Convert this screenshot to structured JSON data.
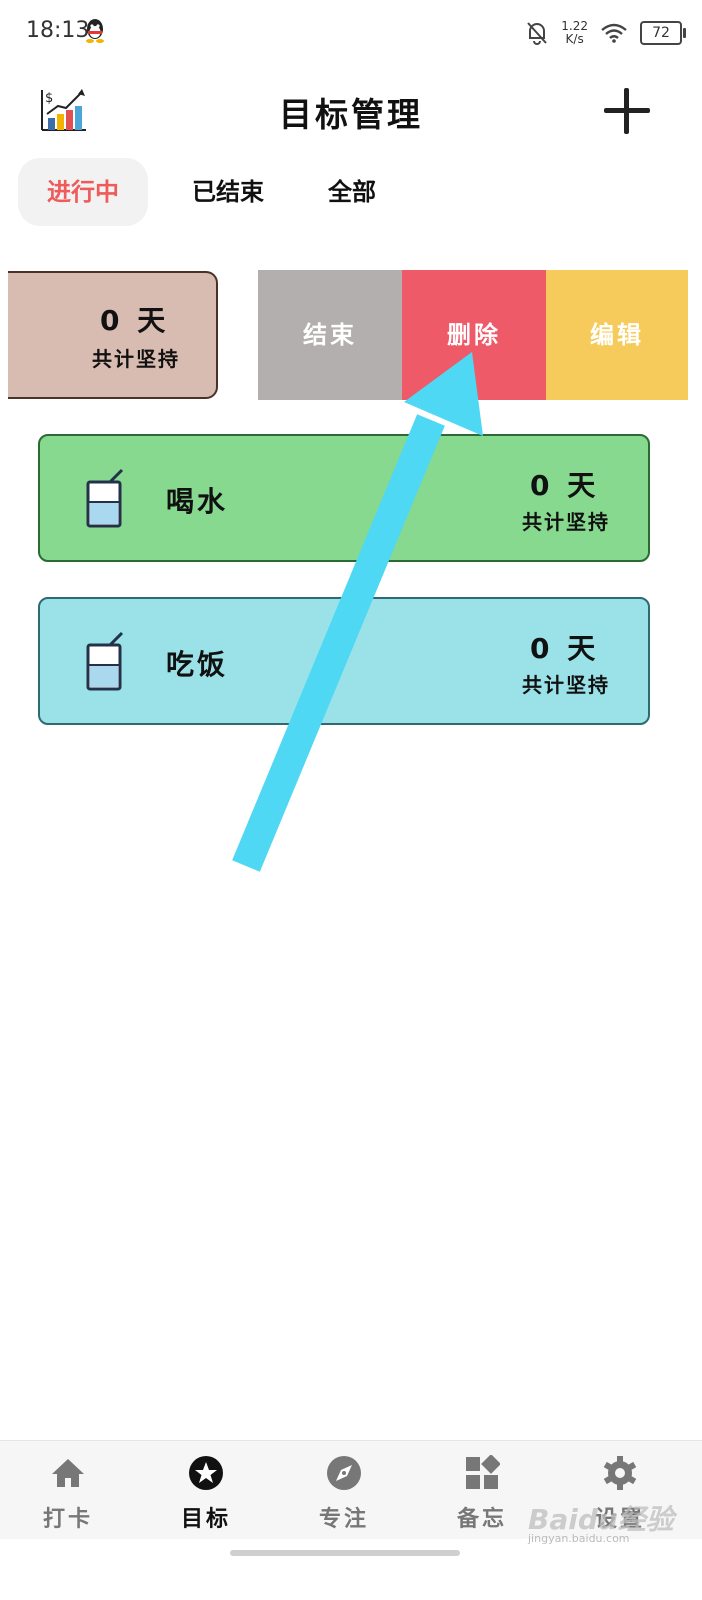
{
  "status_bar": {
    "time": "18:13",
    "net_speed_value": "1.22",
    "net_speed_unit": "K/s",
    "battery": "72"
  },
  "header": {
    "title": "目标管理"
  },
  "tabs": [
    {
      "label": "进行中",
      "active": true
    },
    {
      "label": "已结束",
      "active": false
    },
    {
      "label": "全部",
      "active": false
    }
  ],
  "swiped_goal": {
    "days": "0 天",
    "total_label": "共计坚持"
  },
  "swipe_actions": {
    "end": "结束",
    "delete": "删除",
    "edit": "编辑"
  },
  "goals": [
    {
      "name": "喝水",
      "days": "0 天",
      "total_label": "共计坚持",
      "color": "#86d98e"
    },
    {
      "name": "吃饭",
      "days": "0 天",
      "total_label": "共计坚持",
      "color": "#9ae2e8"
    }
  ],
  "bottom_nav": [
    {
      "label": "打卡",
      "icon": "home-icon"
    },
    {
      "label": "目标",
      "icon": "star-icon",
      "active": true
    },
    {
      "label": "专注",
      "icon": "compass-icon"
    },
    {
      "label": "备忘",
      "icon": "widgets-icon"
    },
    {
      "label": "设置",
      "icon": "gear-icon"
    }
  ],
  "watermark": {
    "text": "Baidu经验",
    "sub": "jingyan.baidu.com"
  },
  "colors": {
    "accent": "#ef5a5a",
    "delete": "#ef5a68",
    "end": "#b4afaf",
    "edit": "#f6cb5c",
    "arrow": "#4fd8f4"
  }
}
